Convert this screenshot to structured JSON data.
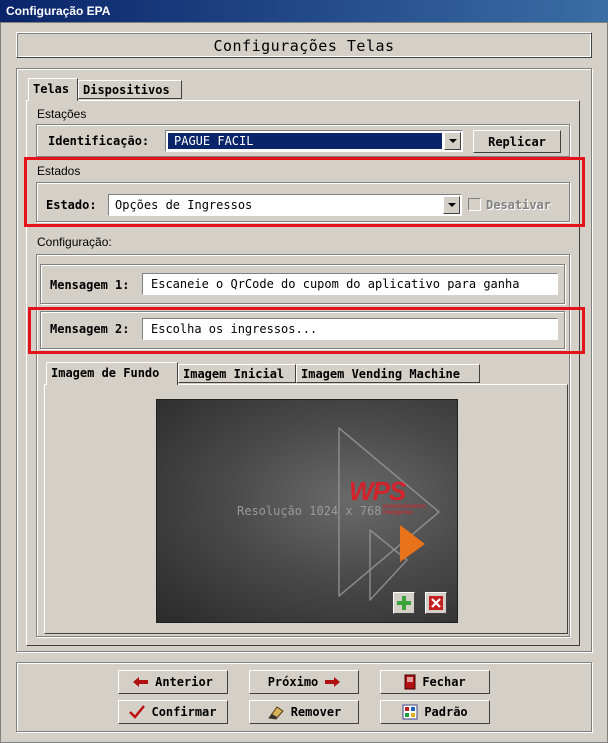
{
  "window": {
    "title": "Configuração EPA"
  },
  "header": {
    "title": "Configurações Telas"
  },
  "tabs": [
    {
      "label": "Telas"
    },
    {
      "label": "Dispositivos"
    }
  ],
  "estacoes": {
    "group_label": "Estações",
    "identificacao_label": "Identificação:",
    "identificacao_value": "PAGUE FACIL",
    "replicar_label": "Replicar"
  },
  "estados": {
    "group_label": "Estados",
    "estado_label": "Estado:",
    "estado_value": "Opções de Ingressos",
    "desativar_label": "Desativar",
    "desativar_checked": false
  },
  "configuracao": {
    "group_label": "Configuração:",
    "mensagem1_label": "Mensagem 1:",
    "mensagem1_value": "Escaneie o QrCode do cupom do aplicativo para ganha",
    "mensagem2_label": "Mensagem 2:",
    "mensagem2_value": "Escolha os ingressos..."
  },
  "image_tabs": [
    {
      "label": "Imagem de Fundo"
    },
    {
      "label": "Imagem Inicial"
    },
    {
      "label": "Imagem Vending Machine"
    }
  ],
  "preview": {
    "resolution_text": "Resolução 1024 x 768",
    "logo_text": "WPS",
    "logo_subtext": "entretenimentos inteligentes"
  },
  "buttons": {
    "anterior": "Anterior",
    "proximo": "Próximo",
    "fechar": "Fechar",
    "confirmar": "Confirmar",
    "remover": "Remover",
    "padrao": "Padrão"
  },
  "colors": {
    "highlight": "#e3121b",
    "selection": "#0a246a",
    "titlebar": "#0a246a"
  }
}
